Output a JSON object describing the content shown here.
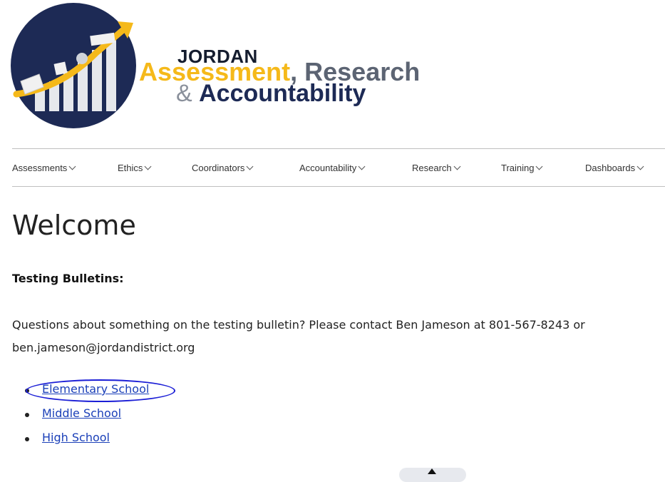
{
  "logo": {
    "line1": "JORDAN",
    "assessment": "Assessment",
    "research": ", Research",
    "amp": "& ",
    "accountability": "Accountability",
    "colors": {
      "navy": "#1d2a55",
      "yellow": "#f5b91a",
      "gray": "#5c6473"
    }
  },
  "nav": {
    "items": [
      {
        "label": "Assessments"
      },
      {
        "label": "Ethics"
      },
      {
        "label": "Coordinators"
      },
      {
        "label": "Accountability"
      },
      {
        "label": "Research"
      },
      {
        "label": "Training"
      },
      {
        "label": "Dashboards"
      }
    ]
  },
  "main": {
    "title": "Welcome",
    "subheading": "Testing Bulletins:",
    "paragraph": "Questions about something on the testing bulletin? Please contact Ben Jameson at 801-567-8243 or ben.jameson@jordandistrict.org",
    "links": [
      {
        "label": "Elementary School"
      },
      {
        "label": "Middle School"
      },
      {
        "label": "High School"
      }
    ]
  },
  "colors": {
    "link": "#1a3fb8",
    "annotation_circle": "#1b1ed6"
  }
}
